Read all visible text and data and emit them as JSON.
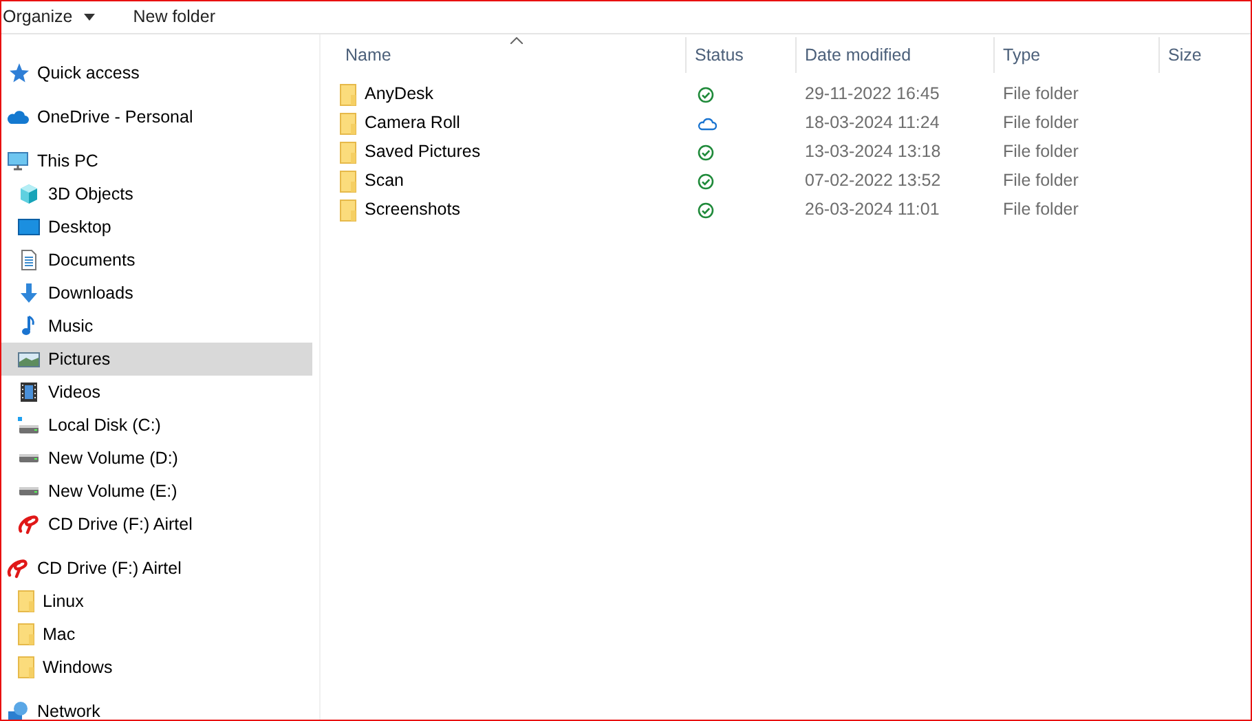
{
  "toolbar": {
    "buttons": [
      {
        "label": "Organize",
        "dropdown": true
      },
      {
        "label": "New folder",
        "dropdown": false
      }
    ]
  },
  "sidebar": {
    "items": [
      {
        "label": "Quick access",
        "kind": "star",
        "selected": false
      },
      {
        "label": "OneDrive - Personal",
        "kind": "cloud",
        "selected": false
      },
      {
        "label": "This PC",
        "kind": "pc",
        "selected": false,
        "children": [
          {
            "label": "3D Objects",
            "kind": "cube",
            "selected": false
          },
          {
            "label": "Desktop",
            "kind": "desktop",
            "selected": false
          },
          {
            "label": "Documents",
            "kind": "document",
            "selected": false
          },
          {
            "label": "Downloads",
            "kind": "download",
            "selected": false
          },
          {
            "label": "Music",
            "kind": "music",
            "selected": false
          },
          {
            "label": "Pictures",
            "kind": "pictures",
            "selected": true
          },
          {
            "label": "Videos",
            "kind": "video",
            "selected": false
          },
          {
            "label": "Local Disk (C:)",
            "kind": "system-disk",
            "selected": false
          },
          {
            "label": "New Volume (D:)",
            "kind": "disk",
            "selected": false
          },
          {
            "label": "New Volume (E:)",
            "kind": "disk",
            "selected": false
          },
          {
            "label": "CD Drive (F:) Airtel",
            "kind": "swirl",
            "selected": false
          }
        ]
      },
      {
        "label": "CD Drive (F:) Airtel",
        "kind": "swirl",
        "selected": false,
        "children": [
          {
            "label": "Linux",
            "kind": "folder",
            "selected": false
          },
          {
            "label": "Mac",
            "kind": "folder",
            "selected": false
          },
          {
            "label": "Windows",
            "kind": "folder",
            "selected": false
          }
        ]
      },
      {
        "label": "Network",
        "kind": "network",
        "selected": false
      }
    ]
  },
  "table": {
    "columns": [
      "Name",
      "Status",
      "Date modified",
      "Type",
      "Size"
    ],
    "rows": [
      {
        "name": "AnyDesk",
        "kind": "available",
        "date": "29-11-2022 16:45",
        "type": "File folder"
      },
      {
        "name": "Camera Roll",
        "kind": "online",
        "date": "18-03-2024 11:24",
        "type": "File folder"
      },
      {
        "name": "Saved Pictures",
        "kind": "available",
        "date": "13-03-2024 13:18",
        "type": "File folder"
      },
      {
        "name": "Scan",
        "kind": "available",
        "date": "07-02-2022 13:52",
        "type": "File folder"
      },
      {
        "name": "Screenshots",
        "kind": "available",
        "date": "26-03-2024 11:01",
        "type": "File folder"
      }
    ]
  }
}
